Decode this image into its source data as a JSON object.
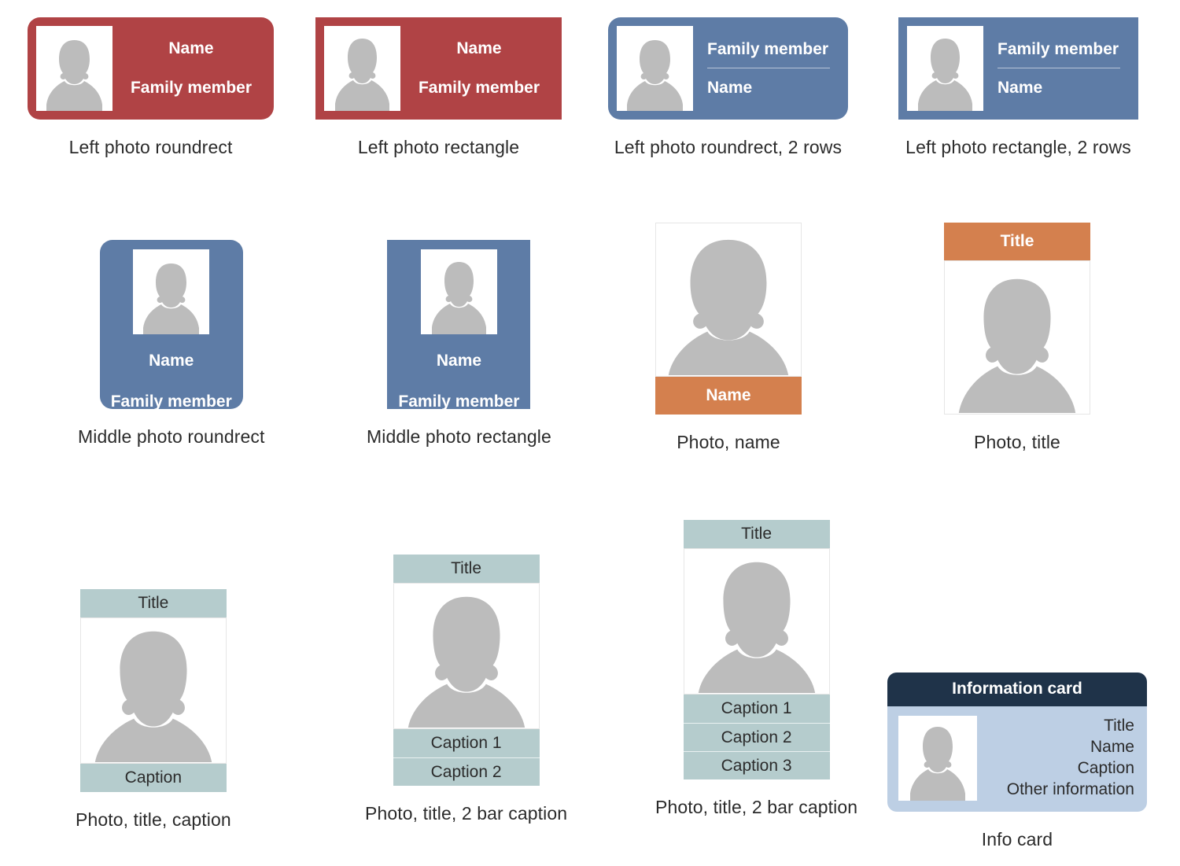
{
  "page": {
    "background": "#ffffff",
    "title": "Picture graphics card shapes library"
  },
  "colors": {
    "red": "#b04345",
    "blue": "#5e7ca6",
    "orange": "#d4804e",
    "teal": "#b5cccd",
    "navy": "#1f3349",
    "info_body": "#bdcfe4",
    "silhouette": "#bcbcbc",
    "caption_text": "#2b2b2b"
  },
  "row1": {
    "cards": [
      {
        "caption": "Left photo roundrect",
        "shape": "roundrect",
        "color": "#b04345",
        "photo": "female-silhouette-photo",
        "line1": "Name",
        "line2": "Family member",
        "layout": "center"
      },
      {
        "caption": "Left photo rectangle",
        "shape": "rectangle",
        "color": "#b04345",
        "photo": "male-silhouette-photo",
        "line1": "Name",
        "line2": "Family member",
        "layout": "center"
      },
      {
        "caption": "Left photo roundrect, 2 rows",
        "shape": "roundrect",
        "color": "#5e7ca6",
        "photo": "female-silhouette-photo",
        "line1": "Family member",
        "line2": "Name",
        "layout": "two-rows"
      },
      {
        "caption": "Left photo rectangle, 2 rows",
        "shape": "rectangle",
        "color": "#5e7ca6",
        "photo": "male-silhouette-photo",
        "line1": "Family member",
        "line2": "Name",
        "layout": "two-rows"
      }
    ]
  },
  "row2": {
    "cards": [
      {
        "caption": "Middle photo roundrect",
        "shape": "roundrect",
        "color": "#5e7ca6",
        "photo": "female-silhouette-photo",
        "name": "Name",
        "role": "Family member"
      },
      {
        "caption": "Middle photo rectangle",
        "shape": "rectangle",
        "color": "#5e7ca6",
        "photo": "male-silhouette-photo",
        "name": "Name",
        "role": "Family member"
      },
      {
        "caption": "Photo, name",
        "photo": "female-silhouette-photo",
        "bar_label": "Name",
        "bar_color": "#d4804e",
        "bar_position": "bottom"
      },
      {
        "caption": "Photo, title",
        "photo": "male-silhouette-photo",
        "bar_label": "Title",
        "bar_color": "#d4804e",
        "bar_position": "top"
      }
    ]
  },
  "row3": {
    "cards": [
      {
        "caption": "Photo, title, caption",
        "photo": "male-silhouette-photo",
        "title": "Title",
        "captions": [
          "Caption"
        ]
      },
      {
        "caption": "Photo, title, 2 bar caption",
        "photo": "male-silhouette-photo",
        "title": "Title",
        "captions": [
          "Caption 1",
          "Caption 2"
        ]
      },
      {
        "caption": "Photo, title, 2 bar caption",
        "photo": "male-silhouette-photo",
        "title": "Title",
        "captions": [
          "Caption 1",
          "Caption 2",
          "Caption 3"
        ]
      },
      {
        "caption": "Info card",
        "header": "Information card",
        "photo": "male-silhouette-photo",
        "lines": [
          "Title",
          "Name",
          "Caption",
          "Other information"
        ]
      }
    ]
  }
}
